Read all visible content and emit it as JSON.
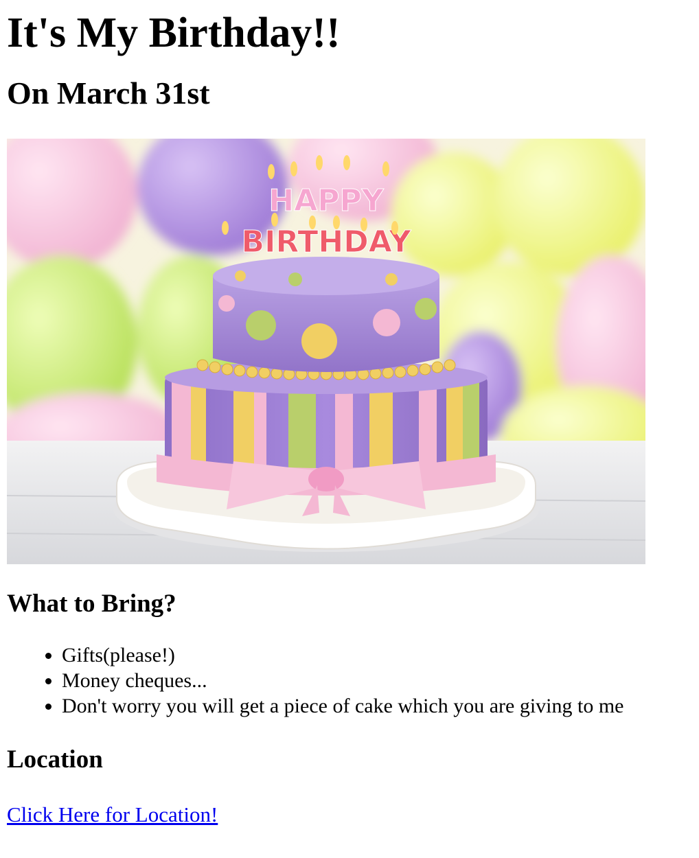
{
  "page": {
    "title": "It's My Birthday!!",
    "subtitle": "On March 31st"
  },
  "hero_image": {
    "alt": "Birthday cake",
    "cake_topper_line1": "HAPPY",
    "cake_topper_line2": "BIRTHDAY",
    "colors": {
      "purple": "#a98ad6",
      "yellow": "#f1cf63",
      "green": "#b9cf6b",
      "pink": "#f4b8d3",
      "background_yellow": "#eef58a",
      "table": "#e8e8ea"
    }
  },
  "bring": {
    "heading": "What to Bring?",
    "items": [
      "Gifts(please!)",
      "Money cheques...",
      "Don't worry you will get a piece of cake which you are giving to me"
    ]
  },
  "location": {
    "heading": "Location",
    "link_text": "Click Here for Location!",
    "link_color": "#0000ee"
  }
}
